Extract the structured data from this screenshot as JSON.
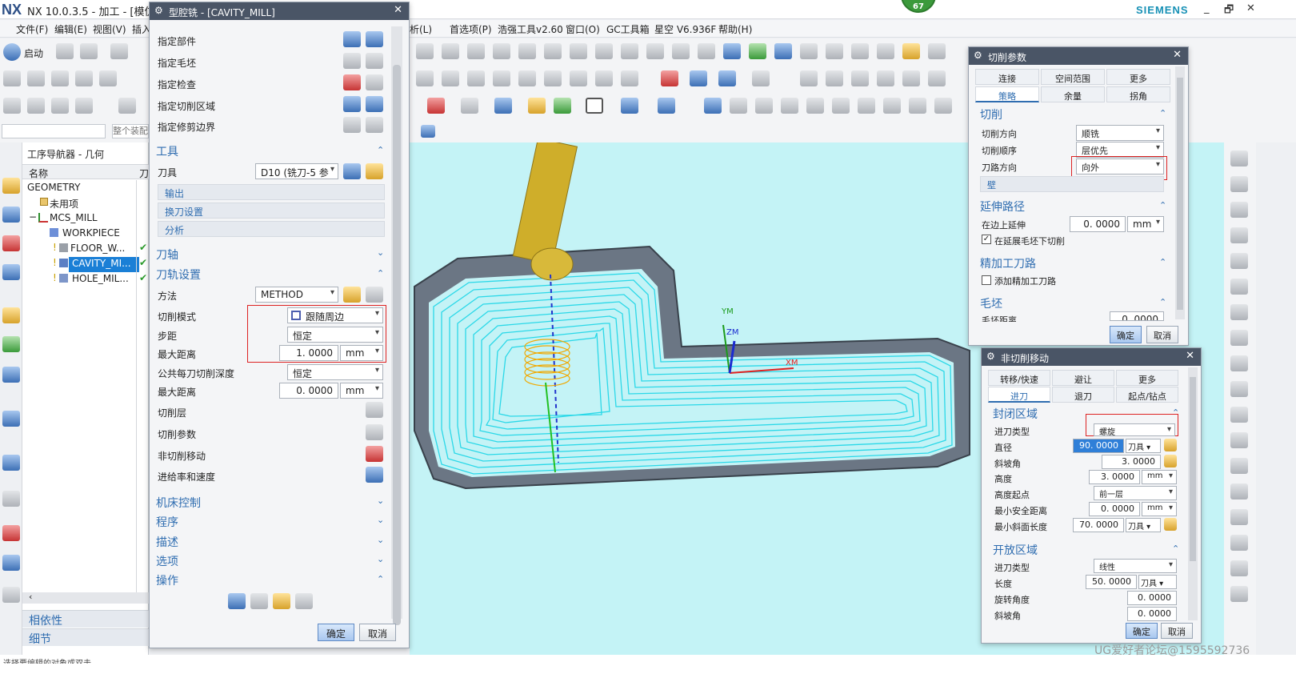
{
  "titlebar": {
    "logo": "NX",
    "title": "NX 10.0.3.5 - 加工 - [模仿ஃ",
    "brand": "SIEMENS",
    "badge": "67",
    "min": "_",
    "restore": "🗗",
    "close": "✕"
  },
  "menubar": {
    "left": [
      "文件(F)",
      "编辑(E)",
      "视图(V)",
      "插入"
    ],
    "right": [
      "析(L)",
      "首选项(P)",
      "浩强工具v2.60",
      "窗口(O)",
      "GC工具箱",
      "星空 V6.936F",
      "帮助(H)"
    ]
  },
  "toolbar": {
    "start_label": "启动",
    "filter_placeholder": "整个装配"
  },
  "navigator": {
    "title": "工序导航器 - 几何",
    "col_name": "名称",
    "col_tool": "刀",
    "items": [
      {
        "label": "GEOMETRY"
      },
      {
        "label": "未用项"
      },
      {
        "label": "MCS_MILL"
      },
      {
        "label": "WORKPIECE"
      },
      {
        "label": "FLOOR_W..."
      },
      {
        "label": "CAVITY_MI..."
      },
      {
        "label": "HOLE_MIL..."
      }
    ],
    "dep": "相依性",
    "detail": "细节"
  },
  "cavity": {
    "title": "型腔铣 - [CAVITY_MILL]",
    "geo": [
      "指定部件",
      "指定毛坯",
      "指定检查",
      "指定切削区域",
      "指定修剪边界"
    ],
    "tool_hdr": "工具",
    "tool_lbl": "刀具",
    "tool_val": "D10 (铣刀-5 参",
    "sub_out": "输出",
    "sub_change": "换刀设置",
    "sub_analysis": "分析",
    "axis_hdr": "刀轴",
    "path_hdr": "刀轨设置",
    "method_lbl": "方法",
    "method_val": "METHOD",
    "cut_mode_lbl": "切削模式",
    "cut_mode_val": "跟随周边",
    "step_lbl": "步距",
    "step_val": "恒定",
    "maxd_lbl": "最大距离",
    "maxd_val": "1. 0000",
    "maxd_unit": "mm",
    "depth_lbl": "公共每刀切削深度",
    "depth_val": "恒定",
    "maxd2_lbl": "最大距离",
    "maxd2_val": "0. 0000",
    "maxd2_unit": "mm",
    "layer": "切削层",
    "params": "切削参数",
    "noncut": "非切削移动",
    "feed": "进给率和速度",
    "machine": "机床控制",
    "program": "程序",
    "desc": "描述",
    "option": "选项",
    "op": "操作",
    "ok": "确定",
    "cancel": "取消"
  },
  "cutparams": {
    "title": "切削参数",
    "tabs1": [
      "连接",
      "空间范围",
      "更多"
    ],
    "tabs2": [
      "策略",
      "余量",
      "拐角"
    ],
    "cut_hdr": "切削",
    "dir_lbl": "切削方向",
    "dir_val": "顺铣",
    "order_lbl": "切削顺序",
    "order_val": "层优先",
    "pathdir_lbl": "刀路方向",
    "pathdir_val": "向外",
    "wall": "壁",
    "ext_hdr": "延伸路径",
    "edge_lbl": "在边上延伸",
    "edge_val": "0. 0000",
    "edge_unit": "mm",
    "blank_chk": "在延展毛坯下切削",
    "finish_hdr": "精加工刀路",
    "finish_chk": "添加精加工刀路",
    "stock_hdr": "毛坯",
    "stock_lbl": "毛坯距离",
    "stock_val": "0. 0000",
    "ok": "确定",
    "cancel": "取消"
  },
  "noncut": {
    "title": "非切削移动",
    "tabs1": [
      "转移/快速",
      "避让",
      "更多"
    ],
    "tabs2": [
      "进刀",
      "退刀",
      "起点/钻点"
    ],
    "closed_hdr": "封闭区域",
    "type_lbl": "进刀类型",
    "type_val": "螺旋",
    "dia_lbl": "直径",
    "dia_val": "90. 0000",
    "dia_unit": "刀具 ▾",
    "ramp_lbl": "斜坡角",
    "ramp_val": "3. 0000",
    "h_lbl": "高度",
    "h_val": "3. 0000",
    "h_unit": "mm",
    "hs_lbl": "高度起点",
    "hs_val": "前一层",
    "safe_lbl": "最小安全距离",
    "safe_val": "0. 0000",
    "safe_unit": "mm",
    "minramp_lbl": "最小斜面长度",
    "minramp_val": "70. 0000",
    "minramp_unit": "刀具 ▾",
    "open_hdr": "开放区域",
    "otype_lbl": "进刀类型",
    "otype_val": "线性",
    "len_lbl": "长度",
    "len_val": "50. 0000",
    "len_unit": "刀具 ▾",
    "rot_lbl": "旋转角度",
    "rot_val": "0. 0000",
    "oramp_lbl": "斜坡角",
    "oramp_val": "0. 0000",
    "ok": "确定",
    "cancel": "取消"
  },
  "viewport": {
    "xm": "XM",
    "ym": "YM",
    "zm": "ZM"
  },
  "footer": {
    "status": "选择要编辑的对象或双击...",
    "watermark": "UG爱好者论坛@1595592736"
  }
}
